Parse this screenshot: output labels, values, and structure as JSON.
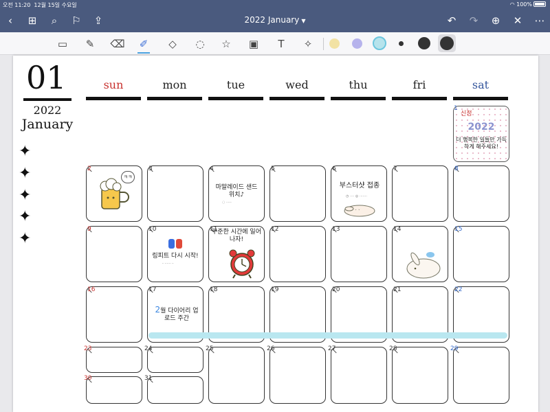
{
  "status": {
    "time": "오전 11:20",
    "date": "12월 15일 수요일",
    "battery": "100%"
  },
  "nav": {
    "title": "2022 January"
  },
  "toolbar": {
    "tools": [
      "sidebar-toggle",
      "pen",
      "eraser",
      "highlighter",
      "shapes",
      "lasso",
      "stickers",
      "image",
      "text",
      "laser-pointer"
    ],
    "colors": [
      "#f2e2a4",
      "#b6b3ec",
      "#b6e3ec"
    ]
  },
  "calendar": {
    "month_number": "01",
    "year": "2022",
    "month_name": "January",
    "weekdays": [
      "sun",
      "mon",
      "tue",
      "wed",
      "thu",
      "fri",
      "sat"
    ],
    "days": [
      "1",
      "2",
      "3",
      "4",
      "5",
      "6",
      "7",
      "8",
      "9",
      "10",
      "11",
      "12",
      "13",
      "14",
      "15",
      "16",
      "17",
      "18",
      "19",
      "20",
      "21",
      "22",
      "23",
      "24",
      "25",
      "26",
      "27",
      "28",
      "29",
      "30",
      "31"
    ]
  },
  "stickers": {
    "special_label": "신정",
    "special_year": "2022",
    "special_text": "더 행복한 일들만 가득하게 해주세요!",
    "jan2_bubble": "ㅋㅋ",
    "jan4_text": "마말레이드 샌드위치♪",
    "jan6_text": "부스터샷 접종",
    "jan10_text": "링피트 다시 시작!",
    "jan11_text": "꾸준한 시간에 일어나자!",
    "jan17_month": "2",
    "jan17_text": "월 다이어리 업로드 주간"
  }
}
